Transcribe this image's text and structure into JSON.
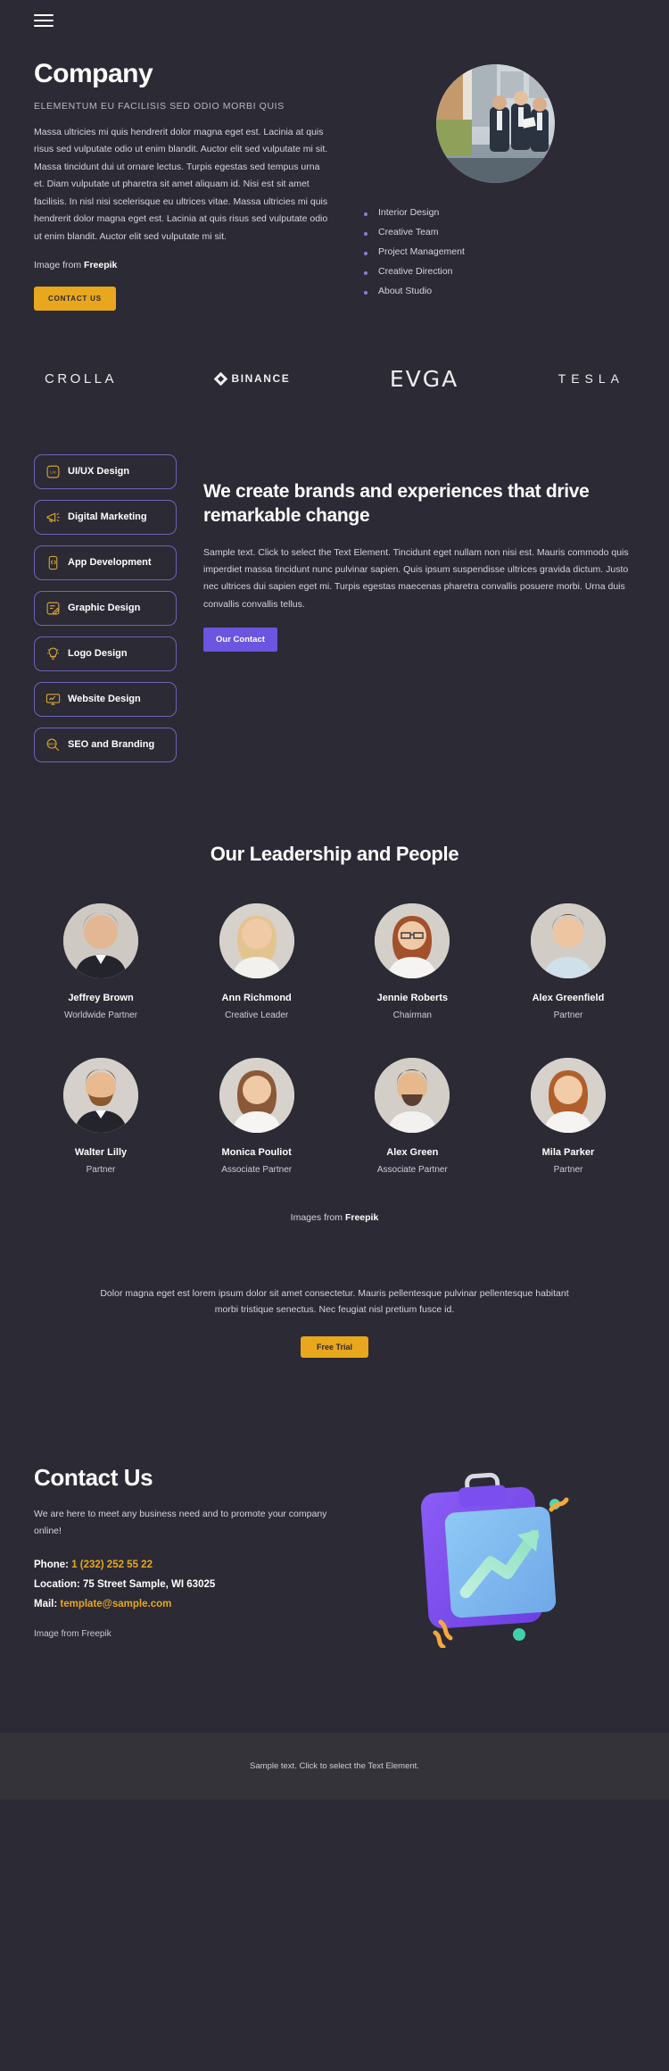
{
  "header": {
    "menu_icon": "hamburger-menu-icon"
  },
  "hero": {
    "title": "Company",
    "subtitle": "ELEMENTUM EU FACILISIS SED ODIO MORBI QUIS",
    "body": "Massa ultricies mi quis hendrerit dolor magna eget est. Lacinia at quis risus sed vulputate odio ut enim blandit. Auctor elit sed vulputate mi sit. Massa tincidunt dui ut ornare lectus. Turpis egestas sed tempus urna et. Diam vulputate ut pharetra sit amet aliquam id. Nisi est sit amet facilisis. In nisl nisi scelerisque eu ultrices vitae. Massa ultricies mi quis hendrerit dolor magna eget est. Lacinia at quis risus sed vulputate odio ut enim blandit. Auctor elit sed vulputate mi sit.",
    "credit_prefix": "Image from ",
    "credit_brand": "Freepik",
    "cta_label": "CONTACT US",
    "features": [
      "Interior Design",
      "Creative Team",
      "Project Management",
      "Creative Direction",
      "About Studio"
    ]
  },
  "logos": [
    {
      "name": "CROLLA",
      "key": "crolla"
    },
    {
      "name": "BINANCE",
      "key": "binance"
    },
    {
      "name": "EVGA",
      "key": "evga"
    },
    {
      "name": "TESLA",
      "key": "tesla"
    }
  ],
  "services": {
    "pills": [
      {
        "label": "UI/UX Design",
        "icon": "ux-square-icon"
      },
      {
        "label": "Digital Marketing",
        "icon": "megaphone-icon"
      },
      {
        "label": "App Development",
        "icon": "code-phone-icon"
      },
      {
        "label": "Graphic Design",
        "icon": "pen-document-icon"
      },
      {
        "label": "Logo Design",
        "icon": "lightbulb-icon"
      },
      {
        "label": "Website Design",
        "icon": "monitor-chart-icon"
      },
      {
        "label": "SEO and Branding",
        "icon": "seo-magnifier-icon"
      }
    ],
    "title": "We create brands and experiences that drive remarkable change",
    "body": "Sample text. Click to select the Text Element. Tincidunt eget nullam non nisi est. Mauris commodo quis imperdiet massa tincidunt nunc pulvinar sapien. Quis ipsum suspendisse ultrices gravida dictum. Justo nec ultrices dui sapien eget mi. Turpis egestas maecenas pharetra convallis posuere morbi. Urna duis convallis convallis tellus.",
    "cta_label": "Our Contact",
    "cta_color": "#6c55e0"
  },
  "team": {
    "title": "Our Leadership and People",
    "row1": [
      {
        "name": "Jeffrey Brown",
        "role": "Worldwide Partner",
        "avatar": "male-gray-hair"
      },
      {
        "name": "Ann Richmond",
        "role": "Creative Leader",
        "avatar": "female-blonde"
      },
      {
        "name": "Jennie Roberts",
        "role": "Chairman",
        "avatar": "female-glasses"
      },
      {
        "name": "Alex Greenfield",
        "role": "Partner",
        "avatar": "male-young"
      }
    ],
    "row2": [
      {
        "name": "Walter Lilly",
        "role": "Partner",
        "avatar": "male-beard"
      },
      {
        "name": "Monica Pouliot",
        "role": "Associate Partner",
        "avatar": "female-brown-hair"
      },
      {
        "name": "Alex Green",
        "role": "Associate Partner",
        "avatar": "male-smiling"
      },
      {
        "name": "Mila Parker",
        "role": "Partner",
        "avatar": "female-red-hair"
      }
    ],
    "credit_prefix": "Images from ",
    "credit_brand": "Freepik"
  },
  "promo": {
    "text": "Dolor magna eget est lorem ipsum dolor sit amet consectetur. Mauris pellentesque pulvinar pellentesque habitant morbi tristique senectus. Nec feugiat nisl pretium fusce id.",
    "cta_label": "Free Trial",
    "cta_color": "#e8a71c"
  },
  "contact": {
    "title": "Contact Us",
    "subtitle": "We are here to meet any business need and to promote your company online!",
    "phone_label": "Phone: ",
    "phone_value": "1 (232) 252 55 22",
    "location_label": "Location: ",
    "location_value": "75 Street Sample, WI 63025",
    "mail_label": "Mail: ",
    "mail_value": "template@sample.com",
    "credit": "Image from Freepik",
    "illustration": "clipboard-growth-chart-illustration"
  },
  "footer": {
    "text": "Sample text. Click to select the Text Element."
  },
  "colors": {
    "background": "#2b2a35",
    "footer_background": "#34333a",
    "amber": "#e8a71c",
    "purple": "#6c55e0",
    "pill_border": "#6f64b8",
    "bullet": "#8a7fd6"
  }
}
